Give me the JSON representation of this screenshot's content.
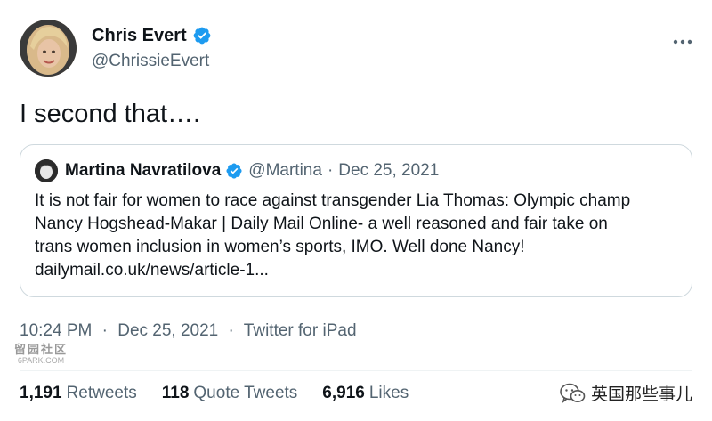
{
  "author": {
    "name": "Chris Evert",
    "handle": "@ChrissieEvert"
  },
  "tweet": {
    "text": "I second that…."
  },
  "quote": {
    "name": "Martina Navratilova",
    "handle": "@Martina",
    "dot": "·",
    "date": "Dec 25, 2021",
    "lines": [
      "It is not fair for women to race against transgender Lia Thomas: Olympic champ",
      "Nancy Hogshead-Makar | Daily Mail Online- a well reasoned and fair take on",
      "trans women inclusion in women’s sports, IMO. Well done Nancy!",
      "dailymail.co.uk/news/article-1..."
    ]
  },
  "meta": {
    "time": "10:24 PM",
    "sep1": "·",
    "date": "Dec 25, 2021",
    "sep2": "·",
    "source": "Twitter for iPad"
  },
  "stats": {
    "retweets_count": "1,191",
    "retweets_label": "Retweets",
    "quotes_count": "118",
    "quotes_label": "Quote Tweets",
    "likes_count": "6,916",
    "likes_label": "Likes"
  },
  "watermarks": {
    "left_cn": "留园社区",
    "left_en": "6PARK.COM",
    "right": "英国那些事儿"
  },
  "icons": {
    "verified": "verified-badge-icon",
    "more": "more-options-icon",
    "wechat": "wechat-icon"
  },
  "colors": {
    "verified": "#1d9bf0",
    "secondary_text": "#536471",
    "border": "#cfd9de"
  }
}
